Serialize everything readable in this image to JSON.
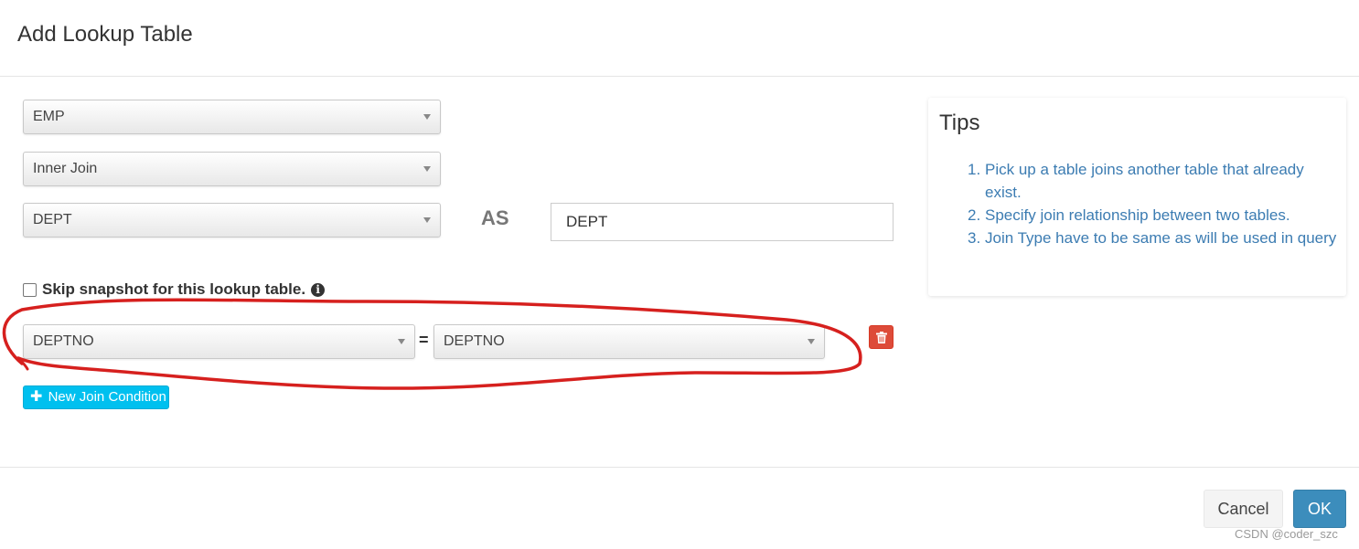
{
  "header": {
    "title": "Add Lookup Table"
  },
  "form": {
    "source_table": {
      "value": "EMP"
    },
    "join_type": {
      "value": "Inner Join"
    },
    "lookup_table": {
      "value": "DEPT"
    },
    "as_label": "AS",
    "alias": {
      "value": "DEPT"
    },
    "skip_snapshot": {
      "label": "Skip snapshot for this lookup table.",
      "checked": false,
      "info_icon": "info-circle-icon"
    },
    "join_condition": {
      "left": "DEPTNO",
      "operator": "=",
      "right": "DEPTNO",
      "delete_icon": "trash-icon"
    },
    "new_join_button": {
      "icon": "plus-icon",
      "label": "New Join Condition"
    }
  },
  "tips": {
    "title": "Tips",
    "items": [
      {
        "num": "1.",
        "text": "Pick up a table joins another table that already exist."
      },
      {
        "num": "2.",
        "text": "Specify join relationship between two tables."
      },
      {
        "num": "3.",
        "text": "Join Type have to be same as will be used in query"
      }
    ]
  },
  "footer": {
    "cancel_label": "Cancel",
    "ok_label": "OK"
  },
  "watermark": "CSDN @coder_szc",
  "colors": {
    "primary": "#3c8dbc",
    "info": "#00c0ef",
    "danger": "#dd4b39",
    "tips_text": "#3c7cb2",
    "annotation": "#d6201e"
  }
}
